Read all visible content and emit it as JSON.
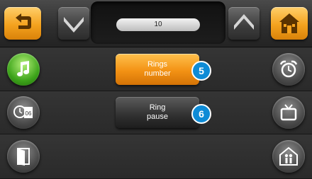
{
  "header": {
    "value": "10",
    "icons": {
      "back": "back-arrow-icon",
      "down": "chevron-down-icon",
      "up": "chevron-up-icon",
      "home": "home-icon"
    }
  },
  "menu": {
    "rings_number": {
      "line1": "Rings",
      "line2": "number",
      "badge": "5"
    },
    "ring_pause": {
      "line1": "Ring",
      "line2": "pause",
      "badge": "6"
    }
  },
  "side_icons": {
    "left": [
      "music-note-icon",
      "clock-calendar-icon",
      "door-icon"
    ],
    "right": [
      "alarm-clock-icon",
      "tv-icon",
      "house-people-icon"
    ]
  },
  "colors": {
    "accent": "#f39214",
    "active_green": "#3ea51b",
    "badge": "#0e8bd6"
  }
}
